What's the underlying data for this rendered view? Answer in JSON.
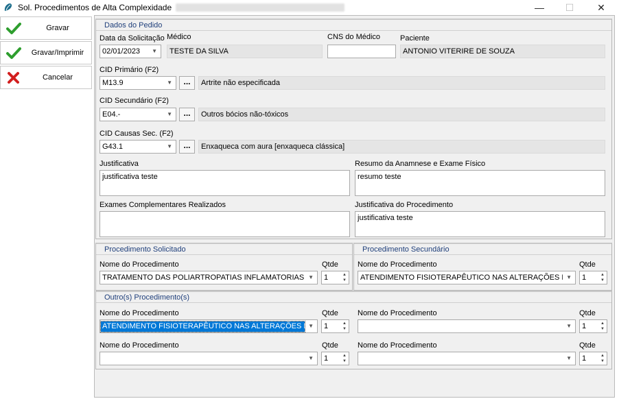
{
  "window": {
    "title": "Sol. Procedimentos de Alta Complexidade",
    "minimize_glyph": "—",
    "maximize_glyph": "☐",
    "close_glyph": "✕"
  },
  "toolbar": {
    "save_label": "Gravar",
    "save_print_label": "Gravar/Imprimir",
    "cancel_label": "Cancelar",
    "check_color": "#2e9e2e",
    "cancel_color": "#d21f1f"
  },
  "order": {
    "group_title": "Dados do Pedido",
    "date_label": "Data da Solicitação",
    "date_value": "02/01/2023",
    "doctor_label": "Médico",
    "doctor_value": "TESTE DA SILVA",
    "cns_label": "CNS do Médico",
    "cns_value": "",
    "patient_label": "Paciente",
    "patient_value": "ANTONIO VITERIRE DE SOUZA",
    "cid_primary_label": "CID Primário (F2)",
    "cid_primary_code": "M13.9",
    "cid_primary_desc": "Artrite não especificada",
    "cid_secondary_label": "CID Secundário (F2)",
    "cid_secondary_code": "E04.-",
    "cid_secondary_desc": "Outros bócios não-tóxicos",
    "cid_causes_label": "CID Causas Sec. (F2)",
    "cid_causes_code": "G43.1",
    "cid_causes_desc": "Enxaqueca com aura [enxaqueca clássica]",
    "dots_label": "...",
    "justification_label": "Justificativa",
    "justification_value": "justificativa teste",
    "summary_label": "Resumo da Anamnese e Exame Físico",
    "summary_value": "resumo teste",
    "exams_label": "Exames Complementares Realizados",
    "exams_value": "",
    "proc_justification_label": "Justificativa do Procedimento",
    "proc_justification_value": "justificativa teste"
  },
  "requested": {
    "group_title": "Procedimento Solicitado",
    "name_label": "Nome do Procedimento",
    "name_value": "TRATAMENTO DAS POLIARTROPATIAS INFLAMATORIAS",
    "qty_label": "Qtde",
    "qty_value": "1"
  },
  "secondary": {
    "group_title": "Procedimento Secundário",
    "name_label": "Nome do Procedimento",
    "name_value": "ATENDIMENTO FISIOTERAPÊUTICO NAS ALTERAÇÕES MOTO",
    "qty_label": "Qtde",
    "qty_value": "1"
  },
  "others": {
    "group_title": "Outro(s) Procedimento(s)",
    "items": [
      {
        "name_label": "Nome do Procedimento",
        "name_value": "ATENDIMENTO FISIOTERAPÊUTICO NAS ALTERAÇÕES MOTO",
        "qty_label": "Qtde",
        "qty_value": "1"
      },
      {
        "name_label": "Nome do Procedimento",
        "name_value": "",
        "qty_label": "Qtde",
        "qty_value": "1"
      },
      {
        "name_label": "Nome do Procedimento",
        "name_value": "",
        "qty_label": "Qtde",
        "qty_value": "1"
      },
      {
        "name_label": "Nome do Procedimento",
        "name_value": "",
        "qty_label": "Qtde",
        "qty_value": "1"
      }
    ]
  }
}
